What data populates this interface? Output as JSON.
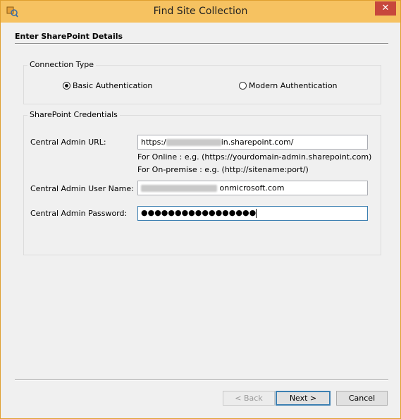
{
  "window": {
    "title": "Find Site Collection",
    "close_glyph": "✕"
  },
  "section": {
    "header": "Enter SharePoint Details"
  },
  "connection_type": {
    "legend": "Connection Type",
    "basic_label": "Basic Authentication",
    "modern_label": "Modern Authentication",
    "selected": "basic"
  },
  "credentials": {
    "legend": "SharePoint Credentials",
    "url_label": "Central Admin URL:",
    "url_prefix": "https:/",
    "url_suffix": "in.sharepoint.com/",
    "hint_online": "For Online : e.g. (https://yourdomain-admin.sharepoint.com)",
    "hint_onprem": "For On-premise : e.g. (http://sitename:port/)",
    "username_label": "Central Admin User Name:",
    "username_suffix": "onmicrosoft.com",
    "password_label": "Central Admin Password:",
    "password_value": "●●●●●●●●●●●●●●●●●"
  },
  "footer": {
    "back_label": "< Back",
    "next_label": "Next >",
    "cancel_label": "Cancel"
  },
  "colors": {
    "titlebar": "#f6c261",
    "close": "#c7473c",
    "focus": "#3c7fb1"
  }
}
